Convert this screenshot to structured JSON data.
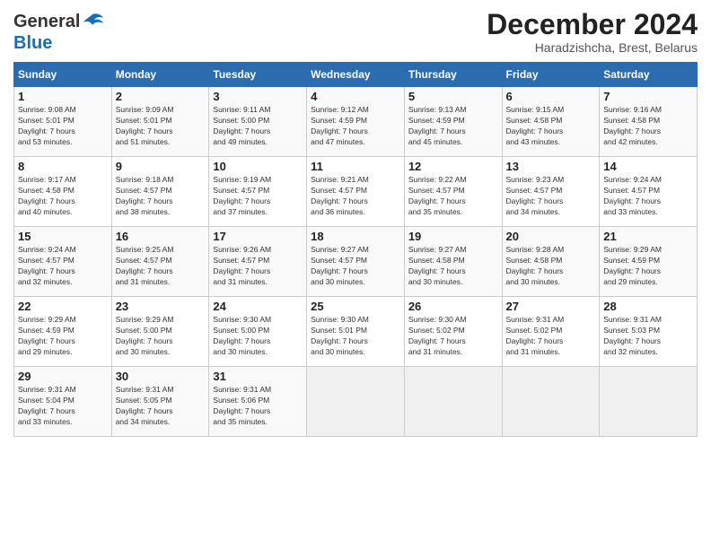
{
  "header": {
    "logo_line1": "General",
    "logo_line2": "Blue",
    "month_title": "December 2024",
    "location": "Haradzishcha, Brest, Belarus"
  },
  "days_of_week": [
    "Sunday",
    "Monday",
    "Tuesday",
    "Wednesday",
    "Thursday",
    "Friday",
    "Saturday"
  ],
  "weeks": [
    [
      {
        "day": "1",
        "info": "Sunrise: 9:08 AM\nSunset: 5:01 PM\nDaylight: 7 hours\nand 53 minutes."
      },
      {
        "day": "2",
        "info": "Sunrise: 9:09 AM\nSunset: 5:01 PM\nDaylight: 7 hours\nand 51 minutes."
      },
      {
        "day": "3",
        "info": "Sunrise: 9:11 AM\nSunset: 5:00 PM\nDaylight: 7 hours\nand 49 minutes."
      },
      {
        "day": "4",
        "info": "Sunrise: 9:12 AM\nSunset: 4:59 PM\nDaylight: 7 hours\nand 47 minutes."
      },
      {
        "day": "5",
        "info": "Sunrise: 9:13 AM\nSunset: 4:59 PM\nDaylight: 7 hours\nand 45 minutes."
      },
      {
        "day": "6",
        "info": "Sunrise: 9:15 AM\nSunset: 4:58 PM\nDaylight: 7 hours\nand 43 minutes."
      },
      {
        "day": "7",
        "info": "Sunrise: 9:16 AM\nSunset: 4:58 PM\nDaylight: 7 hours\nand 42 minutes."
      }
    ],
    [
      {
        "day": "8",
        "info": "Sunrise: 9:17 AM\nSunset: 4:58 PM\nDaylight: 7 hours\nand 40 minutes."
      },
      {
        "day": "9",
        "info": "Sunrise: 9:18 AM\nSunset: 4:57 PM\nDaylight: 7 hours\nand 38 minutes."
      },
      {
        "day": "10",
        "info": "Sunrise: 9:19 AM\nSunset: 4:57 PM\nDaylight: 7 hours\nand 37 minutes."
      },
      {
        "day": "11",
        "info": "Sunrise: 9:21 AM\nSunset: 4:57 PM\nDaylight: 7 hours\nand 36 minutes."
      },
      {
        "day": "12",
        "info": "Sunrise: 9:22 AM\nSunset: 4:57 PM\nDaylight: 7 hours\nand 35 minutes."
      },
      {
        "day": "13",
        "info": "Sunrise: 9:23 AM\nSunset: 4:57 PM\nDaylight: 7 hours\nand 34 minutes."
      },
      {
        "day": "14",
        "info": "Sunrise: 9:24 AM\nSunset: 4:57 PM\nDaylight: 7 hours\nand 33 minutes."
      }
    ],
    [
      {
        "day": "15",
        "info": "Sunrise: 9:24 AM\nSunset: 4:57 PM\nDaylight: 7 hours\nand 32 minutes."
      },
      {
        "day": "16",
        "info": "Sunrise: 9:25 AM\nSunset: 4:57 PM\nDaylight: 7 hours\nand 31 minutes."
      },
      {
        "day": "17",
        "info": "Sunrise: 9:26 AM\nSunset: 4:57 PM\nDaylight: 7 hours\nand 31 minutes."
      },
      {
        "day": "18",
        "info": "Sunrise: 9:27 AM\nSunset: 4:57 PM\nDaylight: 7 hours\nand 30 minutes."
      },
      {
        "day": "19",
        "info": "Sunrise: 9:27 AM\nSunset: 4:58 PM\nDaylight: 7 hours\nand 30 minutes."
      },
      {
        "day": "20",
        "info": "Sunrise: 9:28 AM\nSunset: 4:58 PM\nDaylight: 7 hours\nand 30 minutes."
      },
      {
        "day": "21",
        "info": "Sunrise: 9:29 AM\nSunset: 4:59 PM\nDaylight: 7 hours\nand 29 minutes."
      }
    ],
    [
      {
        "day": "22",
        "info": "Sunrise: 9:29 AM\nSunset: 4:59 PM\nDaylight: 7 hours\nand 29 minutes."
      },
      {
        "day": "23",
        "info": "Sunrise: 9:29 AM\nSunset: 5:00 PM\nDaylight: 7 hours\nand 30 minutes."
      },
      {
        "day": "24",
        "info": "Sunrise: 9:30 AM\nSunset: 5:00 PM\nDaylight: 7 hours\nand 30 minutes."
      },
      {
        "day": "25",
        "info": "Sunrise: 9:30 AM\nSunset: 5:01 PM\nDaylight: 7 hours\nand 30 minutes."
      },
      {
        "day": "26",
        "info": "Sunrise: 9:30 AM\nSunset: 5:02 PM\nDaylight: 7 hours\nand 31 minutes."
      },
      {
        "day": "27",
        "info": "Sunrise: 9:31 AM\nSunset: 5:02 PM\nDaylight: 7 hours\nand 31 minutes."
      },
      {
        "day": "28",
        "info": "Sunrise: 9:31 AM\nSunset: 5:03 PM\nDaylight: 7 hours\nand 32 minutes."
      }
    ],
    [
      {
        "day": "29",
        "info": "Sunrise: 9:31 AM\nSunset: 5:04 PM\nDaylight: 7 hours\nand 33 minutes."
      },
      {
        "day": "30",
        "info": "Sunrise: 9:31 AM\nSunset: 5:05 PM\nDaylight: 7 hours\nand 34 minutes."
      },
      {
        "day": "31",
        "info": "Sunrise: 9:31 AM\nSunset: 5:06 PM\nDaylight: 7 hours\nand 35 minutes."
      },
      {
        "day": "",
        "info": ""
      },
      {
        "day": "",
        "info": ""
      },
      {
        "day": "",
        "info": ""
      },
      {
        "day": "",
        "info": ""
      }
    ]
  ]
}
